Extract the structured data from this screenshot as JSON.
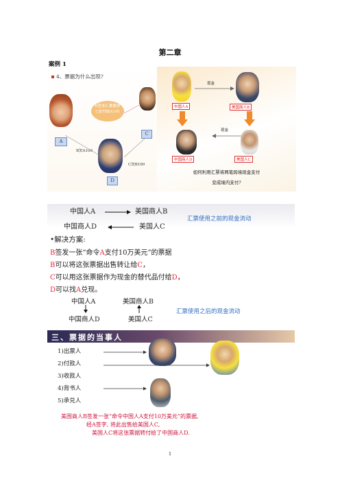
{
  "page": {
    "title": "第二章",
    "case_label": "案例 1",
    "page_number": "1"
  },
  "slide1": {
    "question": "4、票据为什么出现?",
    "bubble_text_line1": "B签发汇票要求",
    "bubble_text_line2": "C支付给A100",
    "label_a": "A",
    "label_c": "C",
    "label_d": "D",
    "b_owes_a": "B欠A100",
    "c_owes_b": "C欠B100"
  },
  "slide2": {
    "cash_top": "现金",
    "cash_mid": "现金",
    "tag_cn_a": "中国人A",
    "tag_us_b": "美国商人B",
    "tag_cn_d": "中国商人D",
    "tag_us_c": "美国人C",
    "caption_line1": "如何利用汇票将两笔跨境现金支付",
    "caption_line2": "变成境内支付?"
  },
  "slide3": {
    "flow1_left": "中国人A",
    "flow1_right": "美国商人B",
    "flow2_left": "中国商人D",
    "flow2_right": "美国人C",
    "note_before": "汇票使用之前的现金流动",
    "solution_title": "•解决方案:",
    "line1_a": "B",
    "line1_b": "签发一张“命令",
    "line1_c": "A",
    "line1_d": "支付10万美元”的票据",
    "line2_a": "B",
    "line2_b": "可以将这张票据出售转让给",
    "line2_c": "C",
    "line2_d": "，",
    "line3_a": "C",
    "line3_b": "可以用这张票据作为现金的替代品付给",
    "line3_c": "D",
    "line3_d": "，",
    "line4_a": "D",
    "line4_b": "可以找",
    "line4_c": "A",
    "line4_d": "兑现。",
    "after_top_left": "中国人A",
    "after_top_right": "美国商人B",
    "after_bottom_left": "中国商人D",
    "after_bottom_right": "美国人C",
    "note_after": "汇票使用之后的现金流动"
  },
  "slide4": {
    "heading": "三、票据的当事人",
    "roles": [
      "1)出票人",
      "2)付款人",
      "3)收款人",
      "4)背书人",
      "5)承兑人"
    ],
    "bottom_line1": "美国商人B签发一张“命令中国人A支付10万美元”的票据,",
    "bottom_line2": "经A签字, 将此出售给美国人C,",
    "bottom_line3": "美国人C将这张票据转付给了中国商人D."
  },
  "colors": {
    "red_accent": "#e22233",
    "blue_note": "#2e6fc0",
    "tag_red": "#d22222"
  }
}
